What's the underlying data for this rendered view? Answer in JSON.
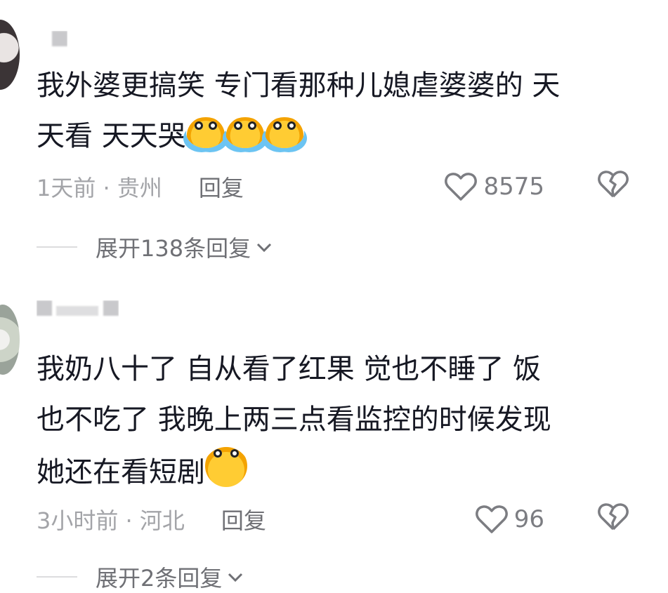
{
  "comments": [
    {
      "text_line1": "我外婆更搞笑 专门看那种儿媳虐婆婆的 天",
      "text_line2": "天看 天天哭",
      "time_location": "1天前 · 贵州",
      "reply_label": "回复",
      "likes": "8575",
      "expand_label": "展开138条回复"
    },
    {
      "text_line1": "我奶八十了 自从看了红果  觉也不睡了 饭",
      "text_line2": "也不吃了 我晚上两三点看监控的时候发现",
      "text_line3": "她还在看短剧",
      "time_location": "3小时前 · 河北",
      "reply_label": "回复",
      "likes": "96",
      "expand_label": "展开2条回复"
    }
  ],
  "icons": {
    "like": "heart-icon",
    "dislike": "broken-heart-icon",
    "expand": "chevron-down-icon",
    "emoji_cry": "crying-emoji-icon",
    "emoji_smile": "smile-emoji-icon"
  },
  "colors": {
    "text": "#161823",
    "meta": "#a3a4a8",
    "reply": "#6f7075"
  }
}
